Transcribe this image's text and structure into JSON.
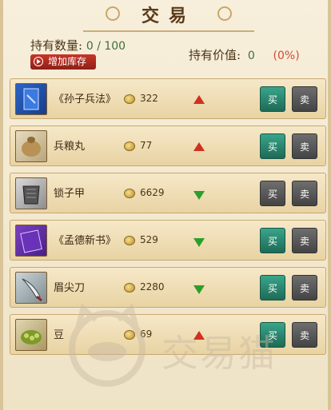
{
  "title": "交易",
  "holding": {
    "label": "持有数量:",
    "value": "0 / 100"
  },
  "worth": {
    "label": "持有价值:",
    "value": "0",
    "percent": "(0%)"
  },
  "add_button": {
    "label": "增加库存"
  },
  "items": [
    {
      "name": "《孙子兵法》",
      "price": "322",
      "trend": "up",
      "icon": "book-blue-icon",
      "buy_active": true,
      "buy": "买",
      "sell": "卖"
    },
    {
      "name": "兵粮丸",
      "price": "77",
      "trend": "up",
      "icon": "grain-sack-icon",
      "buy_active": true,
      "buy": "买",
      "sell": "卖"
    },
    {
      "name": "锁子甲",
      "price": "6629",
      "trend": "down",
      "icon": "armor-icon",
      "buy_active": false,
      "buy": "买",
      "sell": "卖"
    },
    {
      "name": "《孟德新书》",
      "price": "529",
      "trend": "down",
      "icon": "book-purple-icon",
      "buy_active": true,
      "buy": "买",
      "sell": "卖"
    },
    {
      "name": "眉尖刀",
      "price": "2280",
      "trend": "down",
      "icon": "blade-icon",
      "buy_active": true,
      "buy": "买",
      "sell": "卖"
    },
    {
      "name": "豆",
      "price": "69",
      "trend": "up",
      "icon": "beans-icon",
      "buy_active": true,
      "buy": "买",
      "sell": "卖"
    }
  ],
  "watermark": "交易猫",
  "colors": {
    "up": "#d0301f",
    "down": "#2e9e2a",
    "buy_active": "#2b8a72",
    "button_inactive": "#555555",
    "add_button": "#b02a20"
  }
}
